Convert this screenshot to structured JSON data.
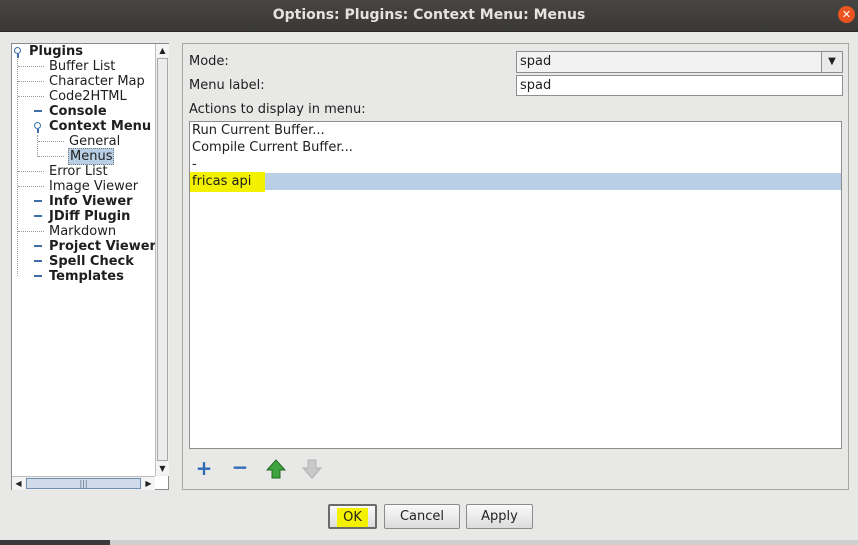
{
  "window": {
    "title": "Options: Plugins: Context Menu: Menus",
    "close_icon": "close-icon"
  },
  "tree": {
    "items": [
      {
        "label": "Plugins",
        "bold": true,
        "expanded": true
      },
      {
        "label": "Buffer List",
        "bold": false
      },
      {
        "label": "Character Map",
        "bold": false
      },
      {
        "label": "Code2HTML",
        "bold": false
      },
      {
        "label": "Console",
        "bold": true
      },
      {
        "label": "Context Menu",
        "bold": true,
        "expanded": true
      },
      {
        "label": "General",
        "bold": false
      },
      {
        "label": "Menus",
        "bold": false,
        "selected": true
      },
      {
        "label": "Error List",
        "bold": false
      },
      {
        "label": "Image Viewer",
        "bold": false
      },
      {
        "label": "Info Viewer",
        "bold": true
      },
      {
        "label": "JDiff Plugin",
        "bold": true
      },
      {
        "label": "Markdown",
        "bold": false
      },
      {
        "label": "Project Viewer",
        "bold": true
      },
      {
        "label": "Spell Check",
        "bold": true
      },
      {
        "label": "Templates",
        "bold": true
      }
    ]
  },
  "form": {
    "mode_label": "Mode:",
    "mode_value": "spad",
    "menu_label_label": "Menu label:",
    "menu_label_value": "spad",
    "actions_label": "Actions to display in menu:",
    "actions": [
      {
        "label": "Run Current Buffer..."
      },
      {
        "label": "Compile Current Buffer..."
      },
      {
        "label": "-"
      },
      {
        "label": "fricas api",
        "selected": true,
        "highlighted": true
      }
    ],
    "toolbar": {
      "add_icon": "plus-icon",
      "remove_icon": "minus-icon",
      "move_up_icon": "arrow-up-icon",
      "move_down_icon": "arrow-down-icon"
    }
  },
  "buttons": {
    "ok": "OK",
    "cancel": "Cancel",
    "apply": "Apply"
  },
  "colors": {
    "selection": "#b8cfe5",
    "highlight": "#f3f000",
    "accent": "#3c6fa8",
    "close": "#e95420"
  }
}
